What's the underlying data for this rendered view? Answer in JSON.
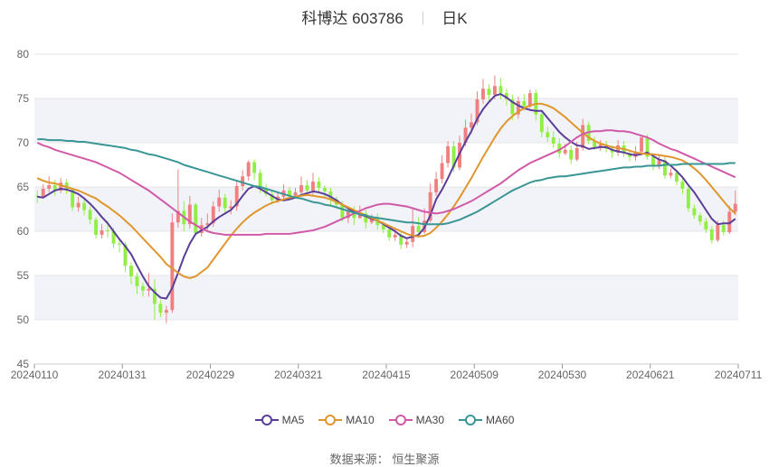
{
  "header": {
    "name": "科博达",
    "code": "603786",
    "period": "日K"
  },
  "source": {
    "label": "数据来源：",
    "value": "恒生聚源"
  },
  "colors": {
    "up": "#f08080",
    "down": "#90ee45",
    "MA5": "#5b3e97",
    "MA10": "#e0962e",
    "MA30": "#d05aa8",
    "MA60": "#3a9595",
    "band": "#f1f3f9",
    "grid": "#e5e5e5"
  },
  "chart_data": {
    "type": "candlestick",
    "ylim": [
      45,
      80
    ],
    "yticks": [
      45,
      50,
      55,
      60,
      65,
      70,
      75,
      80
    ],
    "xticks": [
      "20240110",
      "20240131",
      "20240229",
      "20240321",
      "20240415",
      "20240509",
      "20240530",
      "20240621",
      "20240711"
    ],
    "legend": [
      "MA5",
      "MA10",
      "MA30",
      "MA60"
    ],
    "candles": [
      [
        64.0,
        63.9,
        64.6,
        63.2
      ],
      [
        63.9,
        64.8,
        65.3,
        63.7
      ],
      [
        64.8,
        65.2,
        66.2,
        64.4
      ],
      [
        65.2,
        64.6,
        65.8,
        64.0
      ],
      [
        64.6,
        65.5,
        66.0,
        64.3
      ],
      [
        65.5,
        64.7,
        65.9,
        64.2
      ],
      [
        64.7,
        62.7,
        64.9,
        62.3
      ],
      [
        62.7,
        63.2,
        63.9,
        62.2
      ],
      [
        63.2,
        62.4,
        63.5,
        61.8
      ],
      [
        62.4,
        61.3,
        62.8,
        60.8
      ],
      [
        61.3,
        59.6,
        61.6,
        59.2
      ],
      [
        59.6,
        60.1,
        60.8,
        59.2
      ],
      [
        60.1,
        60.0,
        61.2,
        59.3
      ],
      [
        60.0,
        58.6,
        60.4,
        58.1
      ],
      [
        58.6,
        58.5,
        59.0,
        57.6
      ],
      [
        58.5,
        56.1,
        58.8,
        55.4
      ],
      [
        56.1,
        54.9,
        56.5,
        54.0
      ],
      [
        54.9,
        53.8,
        55.3,
        52.9
      ],
      [
        53.8,
        53.3,
        54.2,
        52.6
      ],
      [
        53.3,
        53.5,
        55.3,
        52.6
      ],
      [
        53.5,
        51.8,
        54.6,
        50.0
      ],
      [
        51.8,
        50.8,
        52.2,
        50.3
      ],
      [
        50.8,
        51.1,
        51.6,
        49.6
      ],
      [
        51.1,
        61.0,
        62.0,
        50.8
      ],
      [
        61.0,
        62.3,
        67.0,
        60.4
      ],
      [
        62.3,
        60.8,
        63.4,
        60.0
      ],
      [
        60.8,
        63.0,
        64.0,
        60.3
      ],
      [
        63.0,
        59.8,
        63.2,
        59.5
      ],
      [
        59.8,
        60.7,
        61.5,
        59.4
      ],
      [
        60.7,
        60.9,
        62.0,
        60.1
      ],
      [
        60.9,
        62.8,
        63.4,
        60.5
      ],
      [
        62.8,
        63.8,
        64.7,
        62.2
      ],
      [
        63.8,
        62.6,
        64.2,
        62.0
      ],
      [
        62.6,
        62.8,
        63.5,
        61.9
      ],
      [
        62.8,
        65.1,
        65.8,
        62.3
      ],
      [
        65.1,
        66.2,
        66.9,
        64.6
      ],
      [
        66.2,
        67.8,
        68.0,
        65.7
      ],
      [
        67.8,
        66.6,
        68.1,
        65.8
      ],
      [
        66.6,
        64.8,
        67.0,
        64.3
      ],
      [
        64.8,
        64.2,
        65.3,
        63.9
      ],
      [
        64.2,
        63.5,
        64.6,
        63.0
      ],
      [
        63.5,
        63.9,
        64.5,
        63.2
      ],
      [
        63.9,
        64.6,
        65.3,
        63.4
      ],
      [
        64.6,
        64.0,
        65.0,
        63.6
      ],
      [
        64.0,
        64.4,
        64.9,
        63.7
      ],
      [
        64.4,
        65.2,
        66.2,
        63.9
      ],
      [
        65.2,
        64.6,
        65.8,
        64.2
      ],
      [
        64.6,
        65.6,
        66.6,
        64.1
      ],
      [
        65.6,
        64.9,
        66.1,
        64.3
      ],
      [
        64.9,
        64.5,
        65.2,
        63.7
      ],
      [
        64.5,
        63.6,
        64.9,
        62.8
      ],
      [
        63.6,
        63.0,
        63.9,
        62.6
      ],
      [
        63.0,
        61.5,
        63.4,
        61.1
      ],
      [
        61.5,
        62.4,
        62.8,
        60.9
      ],
      [
        62.4,
        61.5,
        62.8,
        60.7
      ],
      [
        61.5,
        62.0,
        62.9,
        61.4
      ],
      [
        62.0,
        61.0,
        62.4,
        60.3
      ],
      [
        61.0,
        61.4,
        61.9,
        60.8
      ],
      [
        61.4,
        60.7,
        62.0,
        60.2
      ],
      [
        60.7,
        60.2,
        61.1,
        59.8
      ],
      [
        60.2,
        59.3,
        60.6,
        58.9
      ],
      [
        59.3,
        59.6,
        60.4,
        58.9
      ],
      [
        59.6,
        58.5,
        60.1,
        58.0
      ],
      [
        58.5,
        58.8,
        59.3,
        58.1
      ],
      [
        58.8,
        60.6,
        62.6,
        58.2
      ],
      [
        60.6,
        59.9,
        61.6,
        59.5
      ],
      [
        59.9,
        61.2,
        62.6,
        59.7
      ],
      [
        61.2,
        64.4,
        65.4,
        61.0
      ],
      [
        64.4,
        65.9,
        66.7,
        64.0
      ],
      [
        65.9,
        67.7,
        68.6,
        65.4
      ],
      [
        67.7,
        69.6,
        70.2,
        67.2
      ],
      [
        69.6,
        67.2,
        70.2,
        66.7
      ],
      [
        67.2,
        70.0,
        70.8,
        66.9
      ],
      [
        70.0,
        71.7,
        72.6,
        69.6
      ],
      [
        71.7,
        72.3,
        73.3,
        71.0
      ],
      [
        72.3,
        74.9,
        75.8,
        72.0
      ],
      [
        74.9,
        76.1,
        77.2,
        74.4
      ],
      [
        76.1,
        75.4,
        76.6,
        74.6
      ],
      [
        75.4,
        76.4,
        77.6,
        74.9
      ],
      [
        76.4,
        75.6,
        77.3,
        74.9
      ],
      [
        75.6,
        74.9,
        76.1,
        74.2
      ],
      [
        74.9,
        73.2,
        75.4,
        72.6
      ],
      [
        73.2,
        74.7,
        75.2,
        72.7
      ],
      [
        74.7,
        74.1,
        75.5,
        73.6
      ],
      [
        74.1,
        75.6,
        76.0,
        73.9
      ],
      [
        75.6,
        73.2,
        76.0,
        72.5
      ],
      [
        73.2,
        71.2,
        73.7,
        70.6
      ],
      [
        71.2,
        70.6,
        71.8,
        70.1
      ],
      [
        70.6,
        69.9,
        71.3,
        69.4
      ],
      [
        69.9,
        68.8,
        70.5,
        68.3
      ],
      [
        68.8,
        69.2,
        69.9,
        68.6
      ],
      [
        69.2,
        68.1,
        69.7,
        67.6
      ],
      [
        68.1,
        69.4,
        70.1,
        67.9
      ],
      [
        69.4,
        72.0,
        72.7,
        69.1
      ],
      [
        72.0,
        70.2,
        72.4,
        69.8
      ],
      [
        70.2,
        69.5,
        70.7,
        69.2
      ],
      [
        69.5,
        69.8,
        70.3,
        69.1
      ],
      [
        69.8,
        69.3,
        70.2,
        68.9
      ],
      [
        69.3,
        68.9,
        69.7,
        68.3
      ],
      [
        68.9,
        69.7,
        70.3,
        68.5
      ],
      [
        69.7,
        68.8,
        70.2,
        68.4
      ],
      [
        68.8,
        68.4,
        69.2,
        67.9
      ],
      [
        68.4,
        69.0,
        69.6,
        68.0
      ],
      [
        69.0,
        70.6,
        70.9,
        68.7
      ],
      [
        70.6,
        68.4,
        70.9,
        68.1
      ],
      [
        68.4,
        67.3,
        68.8,
        66.9
      ],
      [
        67.3,
        68.0,
        68.6,
        67.0
      ],
      [
        68.0,
        66.3,
        68.4,
        65.9
      ],
      [
        66.3,
        66.6,
        67.1,
        66.0
      ],
      [
        66.6,
        65.6,
        67.0,
        65.2
      ],
      [
        65.6,
        64.8,
        66.0,
        64.2
      ],
      [
        64.8,
        62.6,
        65.1,
        62.2
      ],
      [
        62.6,
        61.8,
        63.0,
        61.4
      ],
      [
        61.8,
        61.1,
        62.1,
        60.7
      ],
      [
        61.1,
        60.2,
        61.5,
        59.8
      ],
      [
        60.2,
        59.0,
        60.6,
        58.6
      ],
      [
        59.0,
        60.7,
        61.2,
        58.8
      ],
      [
        60.7,
        59.9,
        61.2,
        59.5
      ],
      [
        59.9,
        62.2,
        62.9,
        59.7
      ],
      [
        62.2,
        63.1,
        64.6,
        61.8
      ]
    ],
    "series": [
      {
        "name": "MA5",
        "values": [
          63.9,
          63.8,
          64.2,
          64.6,
          64.8,
          64.7,
          64.5,
          64.2,
          63.7,
          63.1,
          62.4,
          61.6,
          60.9,
          60.0,
          59.1,
          58.3,
          57.4,
          56.1,
          54.9,
          53.8,
          53.1,
          52.5,
          52.4,
          53.6,
          55.3,
          57.1,
          58.6,
          59.7,
          60.1,
          60.5,
          61.1,
          61.6,
          62.0,
          62.4,
          63.1,
          64.0,
          64.8,
          65.1,
          64.8,
          64.4,
          64.0,
          63.6,
          63.5,
          63.6,
          63.8,
          64.1,
          64.3,
          64.5,
          64.4,
          64.2,
          63.9,
          63.5,
          63.0,
          62.6,
          62.2,
          61.9,
          61.7,
          61.4,
          61.2,
          60.8,
          60.4,
          60.0,
          59.5,
          59.2,
          59.4,
          59.6,
          60.4,
          61.8,
          63.6,
          64.7,
          66.0,
          67.4,
          68.8,
          70.1,
          71.3,
          72.7,
          73.8,
          74.6,
          75.3,
          75.5,
          75.1,
          74.6,
          74.2,
          73.9,
          73.7,
          73.6,
          73.6,
          72.8,
          72.0,
          71.2,
          70.6,
          70.1,
          69.7,
          69.6,
          69.3,
          69.4,
          69.5,
          69.5,
          69.2,
          69.0,
          68.9,
          68.7,
          68.6,
          68.7,
          68.9,
          68.5,
          68.1,
          67.9,
          67.4,
          66.8,
          66.1,
          65.2,
          64.4,
          63.4,
          62.4,
          61.4,
          60.8,
          60.9,
          60.9,
          61.4
        ]
      },
      {
        "name": "MA10",
        "values": [
          66.0,
          65.7,
          65.5,
          65.4,
          65.2,
          65.0,
          64.8,
          64.6,
          64.3,
          64.0,
          63.7,
          63.2,
          62.8,
          62.3,
          61.8,
          61.2,
          60.6,
          59.9,
          59.2,
          58.5,
          57.8,
          57.1,
          56.3,
          55.8,
          55.3,
          54.9,
          54.7,
          54.9,
          55.4,
          55.9,
          56.8,
          57.7,
          58.6,
          59.5,
          60.3,
          61.0,
          61.6,
          62.1,
          62.5,
          62.9,
          63.2,
          63.4,
          63.6,
          63.8,
          63.9,
          64.0,
          64.1,
          64.0,
          63.9,
          63.8,
          63.6,
          63.3,
          63.0,
          62.7,
          62.4,
          62.1,
          61.8,
          61.5,
          61.2,
          60.9,
          60.6,
          60.3,
          60.0,
          59.7,
          59.5,
          59.4,
          59.5,
          59.8,
          60.4,
          61.1,
          61.9,
          62.8,
          63.8,
          64.9,
          66.0,
          67.2,
          68.4,
          69.5,
          70.6,
          71.6,
          72.4,
          73.0,
          73.5,
          73.9,
          74.2,
          74.4,
          74.4,
          74.2,
          73.9,
          73.4,
          72.9,
          72.3,
          71.7,
          71.1,
          70.6,
          70.2,
          69.9,
          69.7,
          69.5,
          69.4,
          69.3,
          69.1,
          68.9,
          68.8,
          68.7,
          68.7,
          68.6,
          68.5,
          68.4,
          68.2,
          68.0,
          67.6,
          67.1,
          66.5,
          65.8,
          65.0,
          64.2,
          63.4,
          62.6,
          62.0
        ]
      },
      {
        "name": "MA30",
        "values": [
          70.0,
          69.7,
          69.5,
          69.2,
          69.0,
          68.8,
          68.6,
          68.4,
          68.2,
          68.0,
          67.8,
          67.5,
          67.2,
          66.9,
          66.6,
          66.2,
          65.8,
          65.4,
          65.0,
          64.6,
          64.1,
          63.6,
          63.1,
          62.6,
          62.1,
          61.6,
          61.1,
          60.7,
          60.3,
          60.0,
          59.8,
          59.7,
          59.6,
          59.6,
          59.6,
          59.6,
          59.6,
          59.6,
          59.6,
          59.7,
          59.7,
          59.7,
          59.7,
          59.7,
          59.8,
          59.9,
          60.0,
          60.1,
          60.3,
          60.5,
          60.8,
          61.1,
          61.4,
          61.7,
          62.0,
          62.3,
          62.6,
          62.8,
          63.0,
          63.1,
          63.1,
          63.0,
          62.9,
          62.8,
          62.6,
          62.4,
          62.2,
          62.1,
          62.0,
          62.1,
          62.3,
          62.5,
          62.8,
          63.1,
          63.4,
          63.8,
          64.2,
          64.6,
          65.0,
          65.4,
          65.9,
          66.4,
          66.9,
          67.3,
          67.7,
          68.0,
          68.3,
          68.6,
          68.9,
          69.2,
          69.6,
          70.1,
          70.6,
          71.0,
          71.2,
          71.3,
          71.3,
          71.4,
          71.4,
          71.3,
          71.3,
          71.2,
          71.0,
          70.8,
          70.6,
          70.3,
          69.9,
          69.6,
          69.3,
          69.1,
          68.8,
          68.5,
          68.2,
          67.9,
          67.6,
          67.3,
          67.0,
          66.7,
          66.4,
          66.1
        ]
      },
      {
        "name": "MA60",
        "values": [
          70.4,
          70.4,
          70.3,
          70.3,
          70.3,
          70.2,
          70.2,
          70.1,
          70.1,
          70.0,
          69.9,
          69.8,
          69.7,
          69.6,
          69.5,
          69.4,
          69.2,
          69.1,
          68.9,
          68.7,
          68.6,
          68.4,
          68.2,
          68.0,
          67.8,
          67.5,
          67.3,
          67.1,
          66.9,
          66.7,
          66.5,
          66.3,
          66.1,
          65.9,
          65.7,
          65.5,
          65.3,
          65.1,
          65.0,
          64.8,
          64.6,
          64.4,
          64.2,
          64.0,
          63.8,
          63.7,
          63.5,
          63.3,
          63.2,
          63.0,
          62.9,
          62.7,
          62.5,
          62.3,
          62.1,
          61.9,
          61.8,
          61.6,
          61.5,
          61.4,
          61.3,
          61.2,
          61.1,
          61.0,
          61.0,
          60.9,
          60.8,
          60.8,
          60.8,
          60.8,
          60.9,
          61.1,
          61.3,
          61.6,
          61.9,
          62.2,
          62.6,
          63.0,
          63.4,
          63.8,
          64.2,
          64.6,
          64.9,
          65.2,
          65.5,
          65.7,
          65.8,
          66.0,
          66.1,
          66.2,
          66.2,
          66.3,
          66.4,
          66.5,
          66.6,
          66.7,
          66.8,
          66.9,
          67.0,
          67.1,
          67.2,
          67.2,
          67.3,
          67.3,
          67.4,
          67.4,
          67.4,
          67.5,
          67.5,
          67.5,
          67.6,
          67.6,
          67.6,
          67.6,
          67.6,
          67.6,
          67.6,
          67.6,
          67.7,
          67.7
        ]
      }
    ]
  }
}
